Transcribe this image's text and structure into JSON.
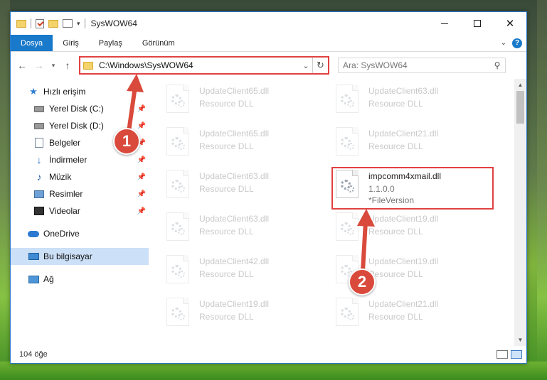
{
  "window": {
    "title": "SysWOW64",
    "accent_color": "#1979ca"
  },
  "ribbon": {
    "tabs": [
      "Dosya",
      "Giriş",
      "Paylaş",
      "Görünüm"
    ],
    "help": "?"
  },
  "address_bar": {
    "path": "C:\\Windows\\SysWOW64",
    "search_placeholder": "Ara: SysWOW64"
  },
  "sidebar": {
    "items": [
      {
        "label": "Hızlı erişim",
        "icon": "star-icon"
      },
      {
        "label": "Yerel Disk (C:)",
        "icon": "drive-icon",
        "pinned": true
      },
      {
        "label": "Yerel Disk (D:)",
        "icon": "drive-icon",
        "pinned": true
      },
      {
        "label": "Belgeler",
        "icon": "document-icon",
        "pinned": true
      },
      {
        "label": "İndirmeler",
        "icon": "download-icon",
        "pinned": true
      },
      {
        "label": "Müzik",
        "icon": "music-icon",
        "pinned": true
      },
      {
        "label": "Resimler",
        "icon": "pictures-icon",
        "pinned": true
      },
      {
        "label": "Videolar",
        "icon": "video-icon",
        "pinned": true
      },
      {
        "label": "OneDrive",
        "icon": "cloud-icon"
      },
      {
        "label": "Bu bilgisayar",
        "icon": "computer-icon",
        "selected": true
      },
      {
        "label": "Ağ",
        "icon": "network-icon"
      }
    ]
  },
  "files": [
    {
      "name": "UpdateClient65.dll",
      "desc": "Resource DLL",
      "faded": true
    },
    {
      "name": "UpdateClient63.dll",
      "desc": "Resource DLL",
      "faded": true
    },
    {
      "name": "UpdateClient65.dll",
      "desc": "Resource DLL",
      "faded": true
    },
    {
      "name": "UpdateClient21.dll",
      "desc": "Resource DLL",
      "faded": true
    },
    {
      "name": "UpdateClient63.dll",
      "desc": "Resource DLL",
      "faded": true
    },
    {
      "name": "impcomm4xmail.dll",
      "desc": "1.1.0.0",
      "desc2": "*FileVersion",
      "faded": false
    },
    {
      "name": "UpdateClient63.dll",
      "desc": "Resource DLL",
      "faded": true
    },
    {
      "name": "UpdateClient19.dll",
      "desc": "Resource DLL",
      "faded": true
    },
    {
      "name": "UpdateClient42.dll",
      "desc": "Resource DLL",
      "faded": true
    },
    {
      "name": "UpdateClient19.dll",
      "desc": "Resource DLL",
      "faded": true
    },
    {
      "name": "UpdateClient19.dll",
      "desc": "Resource DLL",
      "faded": true
    },
    {
      "name": "UpdateClient21.dll",
      "desc": "Resource DLL",
      "faded": true
    }
  ],
  "status": {
    "item_count": "104 öğe"
  },
  "callouts": {
    "first": "1",
    "second": "2",
    "color": "#d94a3c"
  }
}
